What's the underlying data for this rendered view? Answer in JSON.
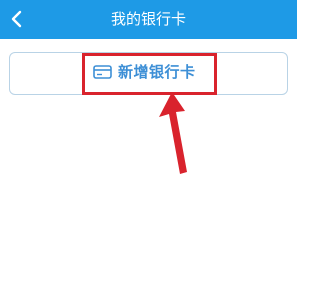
{
  "nav": {
    "title": "我的银行卡",
    "back_icon": "chevron-left-icon"
  },
  "actions": {
    "add_card_label": "新增银行卡",
    "card_icon": "credit-card-icon"
  },
  "annotation": {
    "highlight_color": "#d9232d",
    "arrow_icon": "arrow-up-icon"
  },
  "colors": {
    "nav_bg": "#1e9ae6",
    "accent_text": "#3d8fd6",
    "border": "#b9d3e6"
  }
}
